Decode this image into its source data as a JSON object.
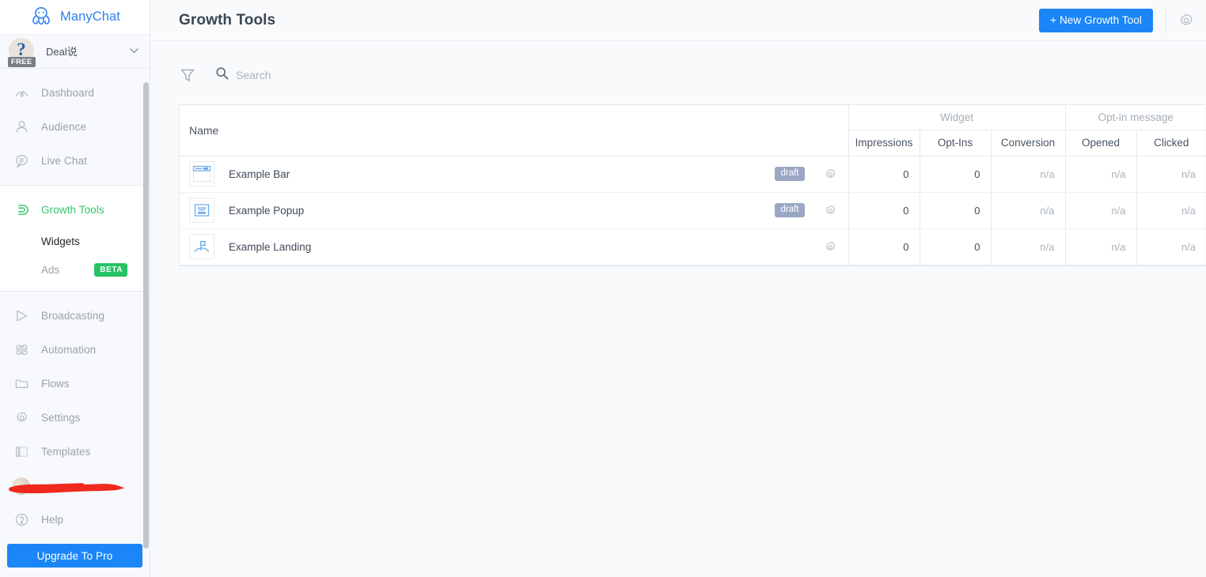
{
  "brand": {
    "name": "ManyChat",
    "logo_icon": "octopus-logo-icon",
    "color": "#2f80ed"
  },
  "account": {
    "name": "Deal说",
    "plan_badge": "FREE",
    "avatar_glyph": "?",
    "chevron_icon": "chevron-down-icon"
  },
  "sidebar": {
    "primary": [
      {
        "label": "Dashboard",
        "icon": "dashboard-gauge-icon"
      },
      {
        "label": "Audience",
        "icon": "user-icon"
      },
      {
        "label": "Live Chat",
        "icon": "chat-bubble-icon"
      }
    ],
    "growth": {
      "label": "Growth Tools",
      "icon": "magnet-icon",
      "active": true,
      "accent": "#35c46a",
      "sub_items": [
        {
          "label": "Widgets",
          "active": true,
          "badge": ""
        },
        {
          "label": "Ads",
          "active": false,
          "badge": "BETA",
          "badge_color": "#26c265"
        }
      ]
    },
    "secondary": [
      {
        "label": "Broadcasting",
        "icon": "send-paperplane-icon"
      },
      {
        "label": "Automation",
        "icon": "atom-icon"
      },
      {
        "label": "Flows",
        "icon": "folder-icon"
      },
      {
        "label": "Settings",
        "icon": "gear-icon"
      },
      {
        "label": "Templates",
        "icon": "templates-icon"
      }
    ],
    "redacted_item": {
      "label": "",
      "icon": "avatar-icon",
      "redaction": "red-scribble"
    },
    "help": {
      "label": "Help",
      "icon": "question-circle-icon"
    },
    "upgrade_button": {
      "label": "Upgrade To Pro",
      "color": "#1b86f7"
    }
  },
  "header": {
    "title": "Growth Tools",
    "new_button": "+ New Growth Tool",
    "new_button_color": "#1b86f7",
    "settings_icon": "gear-icon"
  },
  "toolbar": {
    "filter_icon": "filter-funnel-icon",
    "search_icon": "search-icon",
    "search_placeholder": "Search",
    "search_value": ""
  },
  "table": {
    "group_headers": [
      {
        "label": "",
        "span": 1
      },
      {
        "label": "Widget",
        "span": 3
      },
      {
        "label": "Opt-in message",
        "span": 2
      }
    ],
    "columns": [
      "Name",
      "Impressions",
      "Opt-Ins",
      "Conversion",
      "Opened",
      "Clicked"
    ],
    "rows": [
      {
        "name": "Example Bar",
        "icon": "widget-bar-icon",
        "status": "draft",
        "gear_icon": "gear-icon",
        "impressions": "0",
        "opt_ins": "0",
        "conversion": "n/a",
        "opened": "n/a",
        "clicked": "n/a"
      },
      {
        "name": "Example Popup",
        "icon": "widget-popup-icon",
        "status": "draft",
        "gear_icon": "gear-icon",
        "impressions": "0",
        "opt_ins": "0",
        "conversion": "n/a",
        "opened": "n/a",
        "clicked": "n/a"
      },
      {
        "name": "Example Landing",
        "icon": "widget-landing-icon",
        "status": "",
        "gear_icon": "gear-icon",
        "impressions": "0",
        "opt_ins": "0",
        "conversion": "n/a",
        "opened": "n/a",
        "clicked": "n/a"
      }
    ]
  }
}
